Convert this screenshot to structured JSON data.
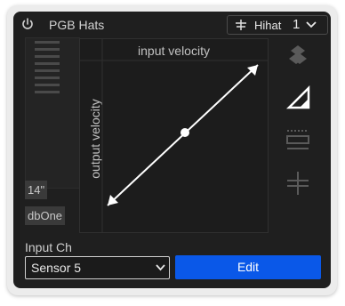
{
  "header": {
    "title": "PGB Hats",
    "selector_label": "Hihat",
    "selector_number": "1"
  },
  "meter": {
    "size_tag": "14\"",
    "brand_tag": "dbOne"
  },
  "curve": {
    "x_label": "input velocity",
    "y_label": "output velocity"
  },
  "input": {
    "label": "Input Ch",
    "selected": "Sensor 5"
  },
  "actions": {
    "edit_label": "Edit"
  },
  "colors": {
    "accent": "#0a58e8",
    "panel": "#1f1f1f"
  }
}
